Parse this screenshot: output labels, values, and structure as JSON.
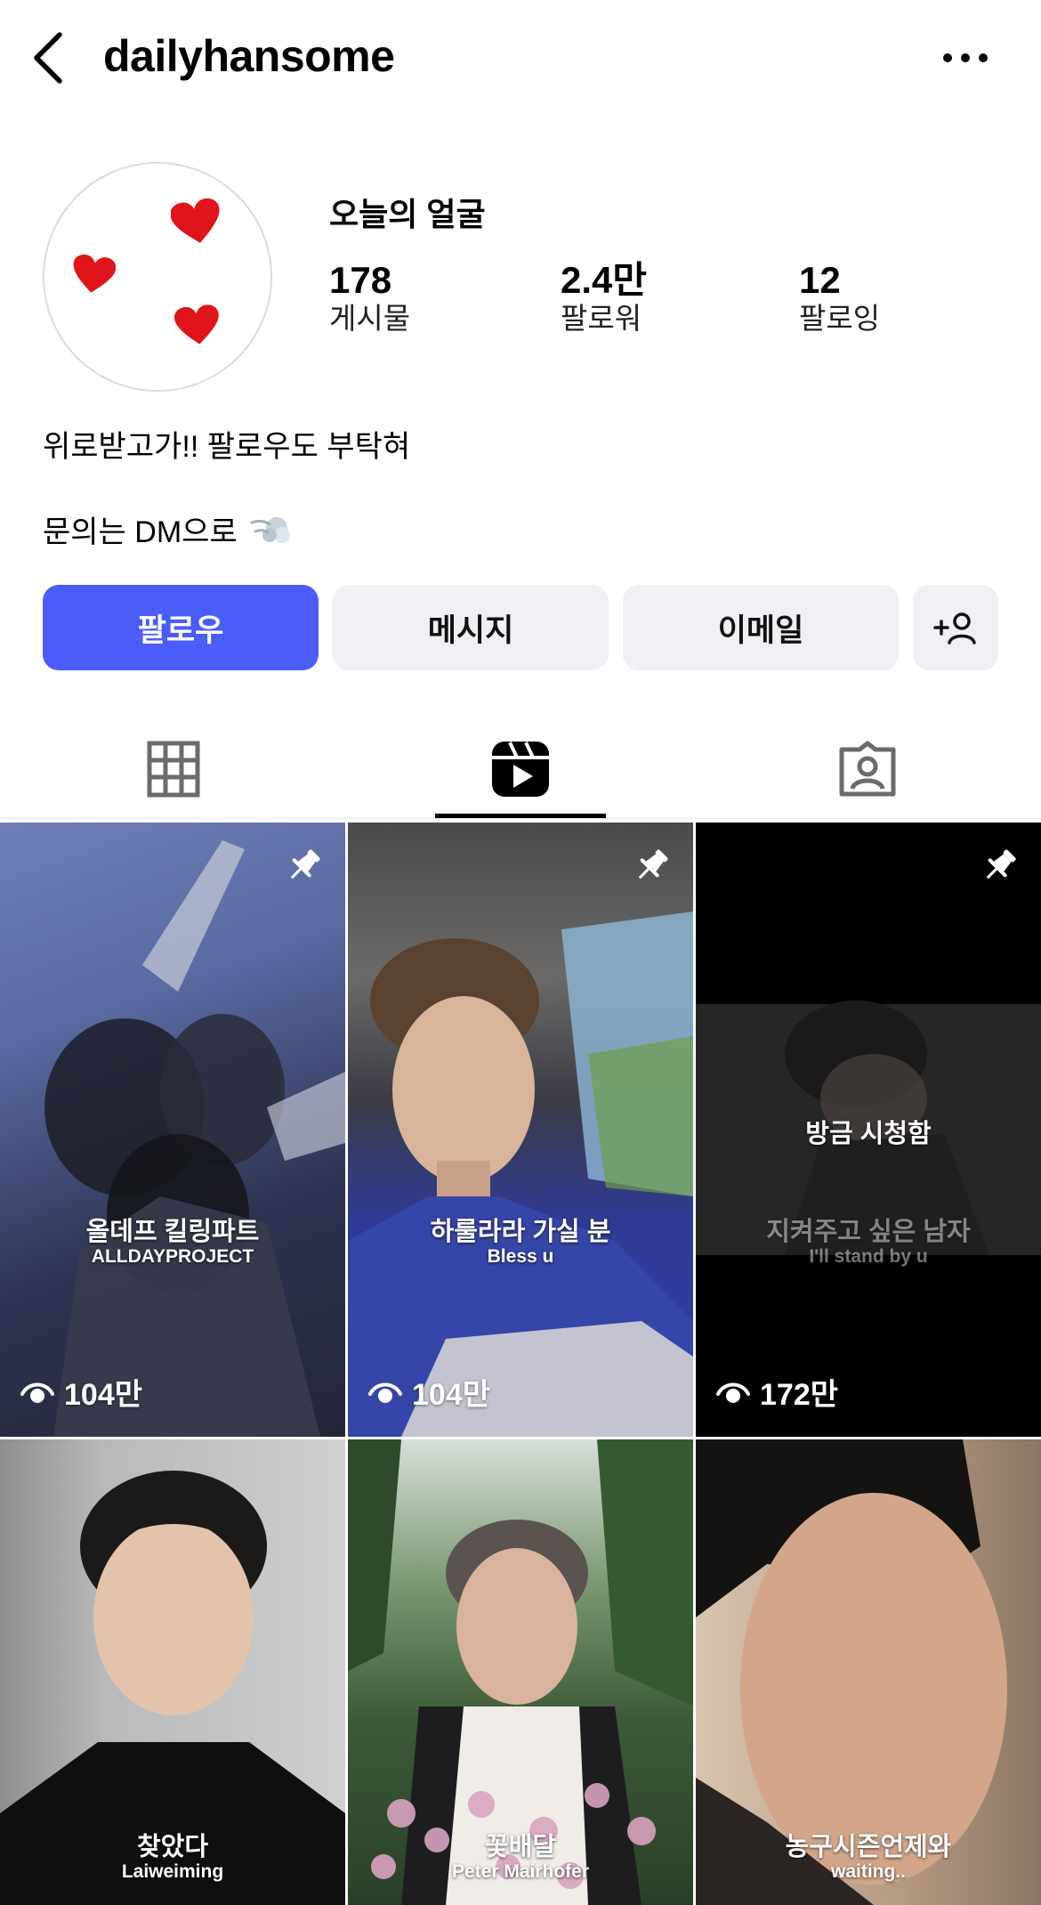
{
  "header": {
    "username": "dailyhansome"
  },
  "profile": {
    "display_name": "오늘의 얼굴",
    "stats": [
      {
        "value": "178",
        "label": "게시물"
      },
      {
        "value": "2.4만",
        "label": "팔로워"
      },
      {
        "value": "12",
        "label": "팔로잉"
      }
    ],
    "bio_line1": "위로받고가!! 팔로우도 부탁혀",
    "bio_line2": "문의는 DM으로",
    "bio_emoji": "dash-icon"
  },
  "actions": {
    "follow": "팔로우",
    "message": "메시지",
    "email": "이메일",
    "add_person_icon": "add-person-icon"
  },
  "tabs": {
    "items": [
      "grid-icon",
      "reels-icon",
      "tagged-icon"
    ],
    "active_index": 1
  },
  "reels": [
    {
      "title": "올데프 킬링파트",
      "subtitle": "ALLDAYPROJECT",
      "views": "104만",
      "pinned": true
    },
    {
      "title": "하룰라라 가실 분",
      "subtitle": "Bless u",
      "views": "104만",
      "pinned": true
    },
    {
      "title": "지켜주고 싶은 남자",
      "subtitle": "I'll stand by u",
      "views": "172만",
      "pinned": true,
      "watched_label": "방금 시청함"
    },
    {
      "title": "찾았다",
      "subtitle": "Laiweiming"
    },
    {
      "title": "꽃배달",
      "subtitle": "Peter Mairhofer"
    },
    {
      "title": "농구시즌언제와",
      "subtitle": "waiting.."
    }
  ],
  "colors": {
    "follow_button": "#4a5df9",
    "secondary_button": "#eff0f3",
    "heart": "#e0151b"
  }
}
